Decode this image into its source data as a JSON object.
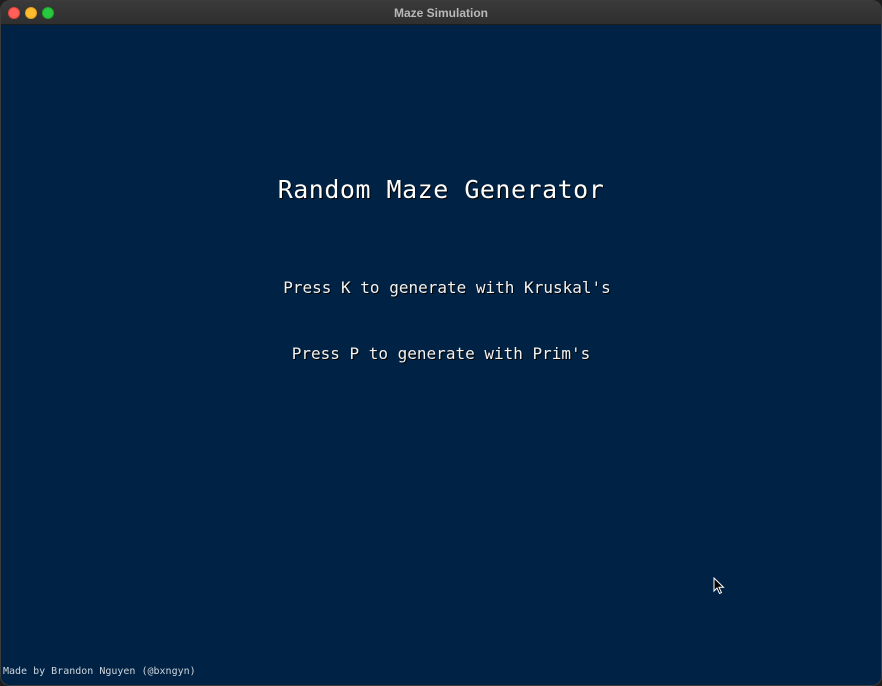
{
  "window": {
    "title": "Maze Simulation"
  },
  "main": {
    "heading": "Random Maze Generator",
    "instructions": [
      "Press K to generate with Kruskal's",
      "Press P to generate with Prim's"
    ],
    "credit": "Made by Brandon Nguyen (@bxngyn)"
  },
  "colors": {
    "background": "#002244",
    "text": "#ffffff"
  },
  "icons": {
    "cursor": "mouse-pointer-icon"
  }
}
